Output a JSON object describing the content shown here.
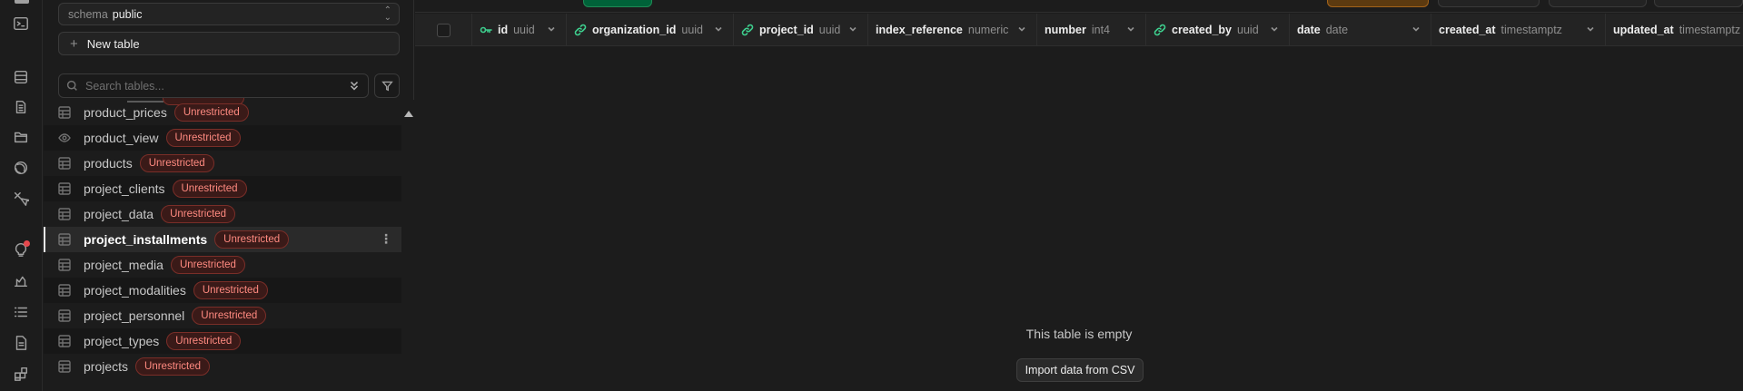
{
  "rail": {
    "icons": [
      "sql-editor-icon",
      "table-editor-icon",
      "database-icon",
      "storage-icon",
      "realtime-icon",
      "auth-icon",
      "advisors-icon",
      "reports-icon",
      "logs-icon",
      "api-docs-icon",
      "integrations-icon"
    ]
  },
  "sidebar": {
    "schema_label": "schema",
    "schema_value": "public",
    "new_table_label": "New table",
    "search_placeholder": "Search tables...",
    "tables": [
      {
        "name": "product_prices",
        "badge": "Unrestricted",
        "icon": "table-icon"
      },
      {
        "name": "product_view",
        "badge": "Unrestricted",
        "icon": "view-icon"
      },
      {
        "name": "products",
        "badge": "Unrestricted",
        "icon": "table-icon"
      },
      {
        "name": "project_clients",
        "badge": "Unrestricted",
        "icon": "table-icon"
      },
      {
        "name": "project_data",
        "badge": "Unrestricted",
        "icon": "table-icon"
      },
      {
        "name": "project_installments",
        "badge": "Unrestricted",
        "icon": "table-icon",
        "active": true
      },
      {
        "name": "project_media",
        "badge": "Unrestricted",
        "icon": "table-icon"
      },
      {
        "name": "project_modalities",
        "badge": "Unrestricted",
        "icon": "table-icon"
      },
      {
        "name": "project_personnel",
        "badge": "Unrestricted",
        "icon": "table-icon"
      },
      {
        "name": "project_types",
        "badge": "Unrestricted",
        "icon": "table-icon"
      },
      {
        "name": "projects",
        "badge": "Unrestricted",
        "icon": "table-icon"
      }
    ]
  },
  "grid": {
    "columns": [
      {
        "name": "id",
        "type": "uuid",
        "icon": "primary-key-icon"
      },
      {
        "name": "organization_id",
        "type": "uuid",
        "icon": "foreign-key-icon"
      },
      {
        "name": "project_id",
        "type": "uuid",
        "icon": "foreign-key-icon"
      },
      {
        "name": "index_reference",
        "type": "numeric",
        "icon": ""
      },
      {
        "name": "number",
        "type": "int4",
        "icon": ""
      },
      {
        "name": "created_by",
        "type": "uuid",
        "icon": "foreign-key-icon"
      },
      {
        "name": "date",
        "type": "date",
        "icon": ""
      },
      {
        "name": "created_at",
        "type": "timestamptz",
        "icon": ""
      },
      {
        "name": "updated_at",
        "type": "timestamptz",
        "icon": ""
      }
    ],
    "empty_message": "This table is empty",
    "import_label": "Import data from CSV"
  },
  "colors": {
    "badge_text": "#ff8a80",
    "badge_bg": "#3a1a18",
    "primary_key": "#3ecf8e",
    "foreign_key": "#3ecf8e",
    "accent_green": "#006239",
    "accent_orange": "#a3631a"
  }
}
